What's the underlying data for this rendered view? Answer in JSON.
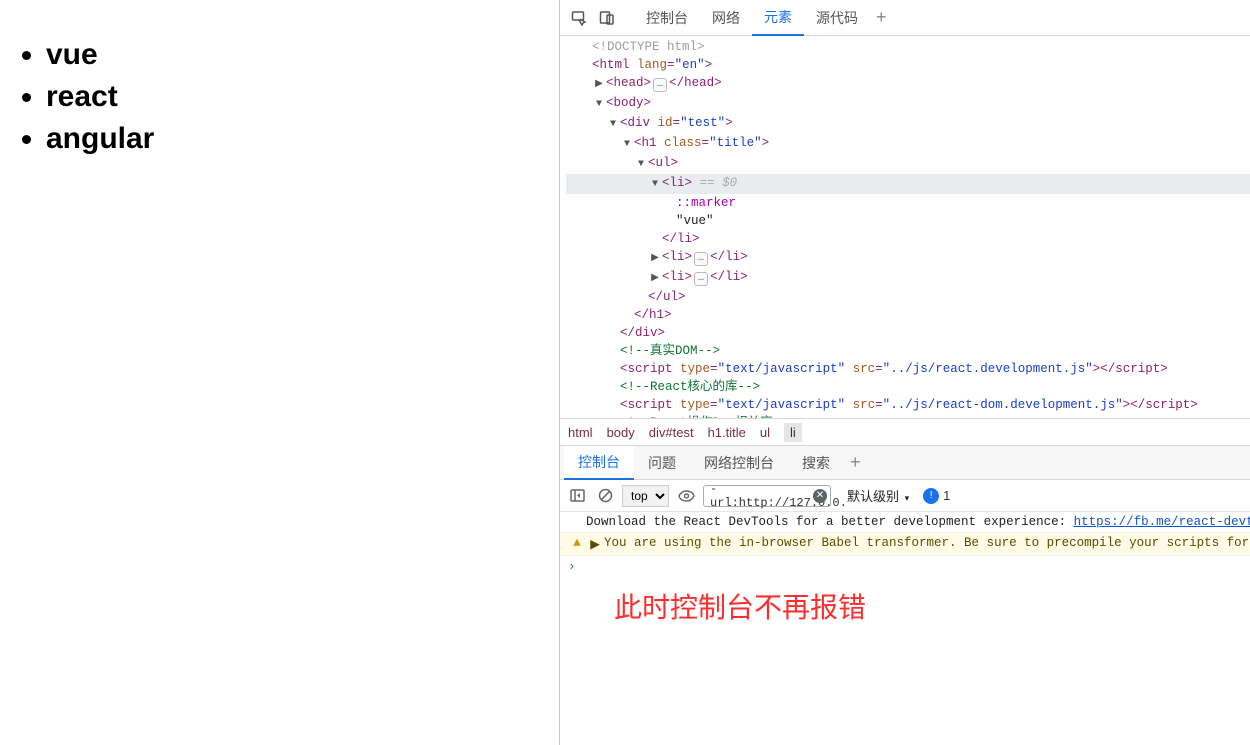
{
  "page": {
    "list": [
      "vue",
      "react",
      "angular"
    ]
  },
  "devtools": {
    "topTabs": [
      "控制台",
      "网络",
      "元素",
      "源代码"
    ],
    "activeTopTab": "元素",
    "lowerTabs": [
      "控制台",
      "问题",
      "网络控制台",
      "搜索"
    ],
    "activeLowerTab": "控制台",
    "breadcrumb": [
      "html",
      "body",
      "div#test",
      "h1.title",
      "ul",
      "li"
    ],
    "breadcrumbActive": "li"
  },
  "dom": {
    "doctype": "<!DOCTYPE html>",
    "htmlOpen": {
      "tag": "html",
      "attr": "lang",
      "val": "en"
    },
    "headOpen": "head",
    "headClose": "head",
    "bodyOpen": "body",
    "divOpen": {
      "tag": "div",
      "attr": "id",
      "val": "test"
    },
    "h1Open": {
      "tag": "h1",
      "attr": "class",
      "val": "title"
    },
    "ulOpen": "ul",
    "liOpen": "li",
    "selRef": "== $0",
    "marker": "::marker",
    "liText": "\"vue\"",
    "liClose": "li",
    "li2": "li",
    "li3": "li",
    "ulClose": "ul",
    "h1Close": "h1",
    "divClose": "div",
    "cmt1": "<!--真实DOM-->",
    "script1": {
      "tag": "script",
      "attrs": [
        [
          "type",
          "text/javascript"
        ],
        [
          "src",
          "../js/react.development.js"
        ]
      ]
    },
    "cmt2": "<!--React核心的库-->",
    "script2": {
      "tag": "script",
      "attrs": [
        [
          "type",
          "text/javascript"
        ],
        [
          "src",
          "../js/react-dom.development.js"
        ]
      ]
    },
    "cmt3": "<!--React操作Dom相关库-->"
  },
  "consoleBar": {
    "context": "top",
    "filter": "-url:http://127.0.0.",
    "levels": "默认级别",
    "badgeCount": "1"
  },
  "consoleMsgs": {
    "info": {
      "pre": "Download the React DevTools for a better development experience: ",
      "link": "https://fb.me/react-devtoo"
    },
    "warn": "You are using the in-browser Babel transformer. Be sure to precompile your scripts for pr",
    "note": "此时控制台不再报错"
  }
}
